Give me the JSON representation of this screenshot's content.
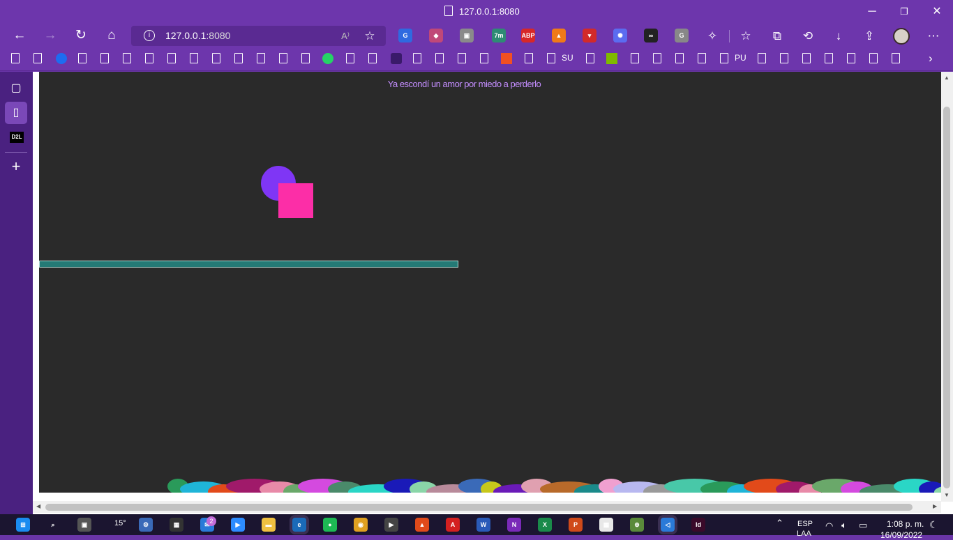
{
  "window": {
    "title": "127.0.0.1:8080",
    "minimize": "─",
    "restore": "❐",
    "close": "✕"
  },
  "toolbar": {
    "url_host": "127.0.0.1",
    "url_port": ":8080",
    "back": "←",
    "forward": "→",
    "refresh": "↻",
    "home": "⌂",
    "read_aloud": "A⁾",
    "add_favorite": "☆",
    "extensions": [
      {
        "name": "translate-icon",
        "label": "G",
        "color": "#2f6ae0"
      },
      {
        "name": "color-icon",
        "label": "◆",
        "color": "#c04878"
      },
      {
        "name": "copy-icon",
        "label": "▣",
        "color": "#8a8a8a"
      },
      {
        "name": "timer-icon",
        "label": "7m",
        "color": "#2e8b74"
      },
      {
        "name": "adblock-icon",
        "label": "ABP",
        "color": "#d72828"
      },
      {
        "name": "avast-icon",
        "label": "▲",
        "color": "#f07a17"
      },
      {
        "name": "save-icon",
        "label": "▾",
        "color": "#d22a2a"
      },
      {
        "name": "gear-flower-icon",
        "label": "✺",
        "color": "#5b6cf0"
      },
      {
        "name": "loop-icon",
        "label": "∞",
        "color": "#222222"
      },
      {
        "name": "grammar-icon",
        "label": "G",
        "color": "#888888"
      }
    ],
    "extensions_menu": "✧",
    "favorites": "☆",
    "collections": "⧉",
    "history": "⟲",
    "downloads": "↓",
    "share": "⇪",
    "more": "⋯"
  },
  "bookmarks": {
    "su_label": "SU",
    "pu_label": "PU"
  },
  "sidebar": {
    "tabs_icon": "▢",
    "page_icon": "▯",
    "d2l_label": "D2L",
    "add_icon": "+"
  },
  "page": {
    "song_text": "Ya escondí un amor por miedo a perderlo",
    "colors": {
      "background": "#2a2a2a",
      "circle": "#7f36f5",
      "square": "#fc2ea7",
      "platform": "#247a76",
      "text": "#c48eff"
    }
  },
  "taskbar": {
    "weather": "15°",
    "mail_badge": "2",
    "language": "ESP",
    "layout": "LAA",
    "time": "1:08 p. m.",
    "date": "16/09/2022",
    "apps": [
      "start-icon",
      "search-icon",
      "task-view-icon",
      "weather-icon",
      "settings-icon",
      "terminal-icon",
      "mail-icon",
      "zoom-icon",
      "explorer-icon",
      "edge-icon",
      "spotify-icon",
      "chrome-icon",
      "media-icon",
      "brave-icon",
      "acrobat-icon",
      "word-icon",
      "onenote-icon",
      "excel-icon",
      "powerpoint-icon",
      "calendar-icon",
      "maps-icon",
      "vscode-icon",
      "indesign-icon"
    ]
  }
}
